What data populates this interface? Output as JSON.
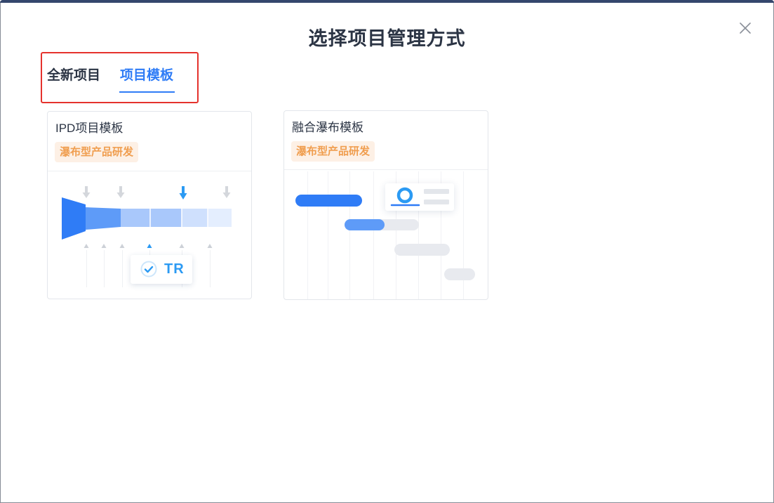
{
  "dialog": {
    "title": "选择项目管理方式"
  },
  "icons": {
    "close": "close-icon",
    "check": "check-circle-icon",
    "arrow_down": "arrow-down-icon",
    "loop": "loop-icon"
  },
  "tabs": [
    {
      "label": "全新项目",
      "active": false
    },
    {
      "label": "项目模板",
      "active": true
    }
  ],
  "templates": [
    {
      "title": "IPD项目模板",
      "tag": "瀑布型产品研发",
      "badge": "TR"
    },
    {
      "title": "融合瀑布模板",
      "tag": "瀑布型产品研发"
    }
  ],
  "colors": {
    "accent": "#2f7cf6",
    "text_primary": "#2b3444",
    "tag_text": "#f09e4f",
    "tag_bg": "#fdf0e5",
    "annotation": "#e5322d",
    "header_bar": "#34476d"
  }
}
